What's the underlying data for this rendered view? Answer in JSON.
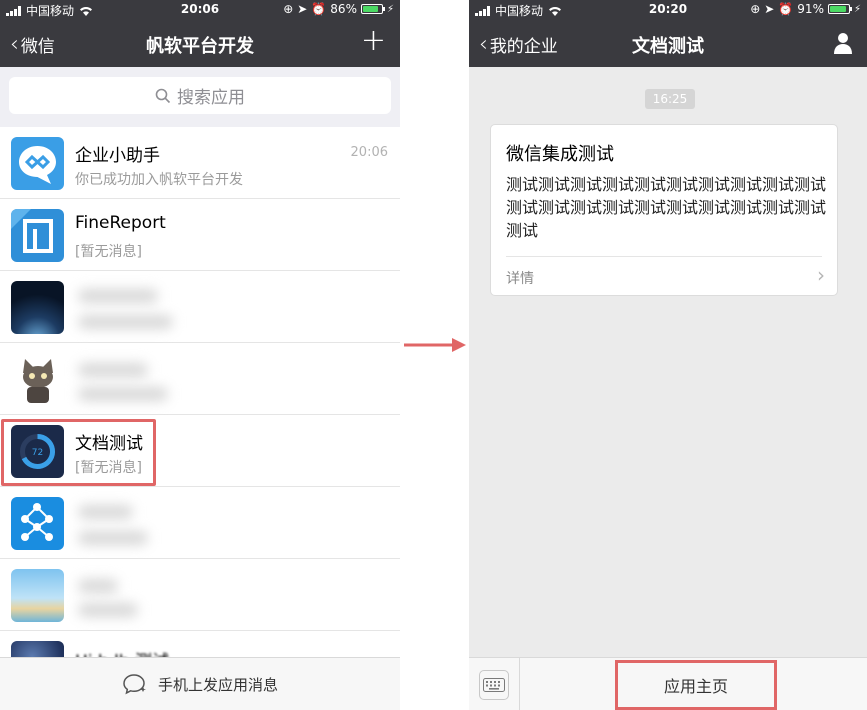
{
  "left_phone": {
    "status": {
      "carrier": "中国移动",
      "time": "20:06",
      "battery": "86%",
      "battery_level": 0.86
    },
    "nav": {
      "back_label": "微信",
      "title": "帆软平台开发"
    },
    "search": {
      "placeholder": "搜索应用"
    },
    "items": [
      {
        "name": "企业小助手",
        "subtitle": "你已成功加入帆软平台开发",
        "time": "20:06"
      },
      {
        "name": "FineReport",
        "subtitle": "[暂无消息]"
      },
      {
        "name": "文档测试",
        "subtitle": "[暂无消息]",
        "badge_number": "72"
      },
      {
        "name": "Hi h lh 测试"
      }
    ],
    "bottom_label": "手机上发应用消息"
  },
  "right_phone": {
    "status": {
      "carrier": "中国移动",
      "time": "20:20",
      "battery": "91%",
      "battery_level": 0.91
    },
    "nav": {
      "back_label": "我的企业",
      "title": "文档测试"
    },
    "message_time": "16:25",
    "card": {
      "title": "微信集成测试",
      "body": "测试测试测试测试测试测试测试测试测试测试测试测试测试测试测试测试测试测试测试测试测试",
      "detail_label": "详情"
    },
    "home_label": "应用主页"
  },
  "colors": {
    "nav_bg": "#3a3a3f",
    "highlight": "#e06666",
    "arrow": "#e06666"
  }
}
